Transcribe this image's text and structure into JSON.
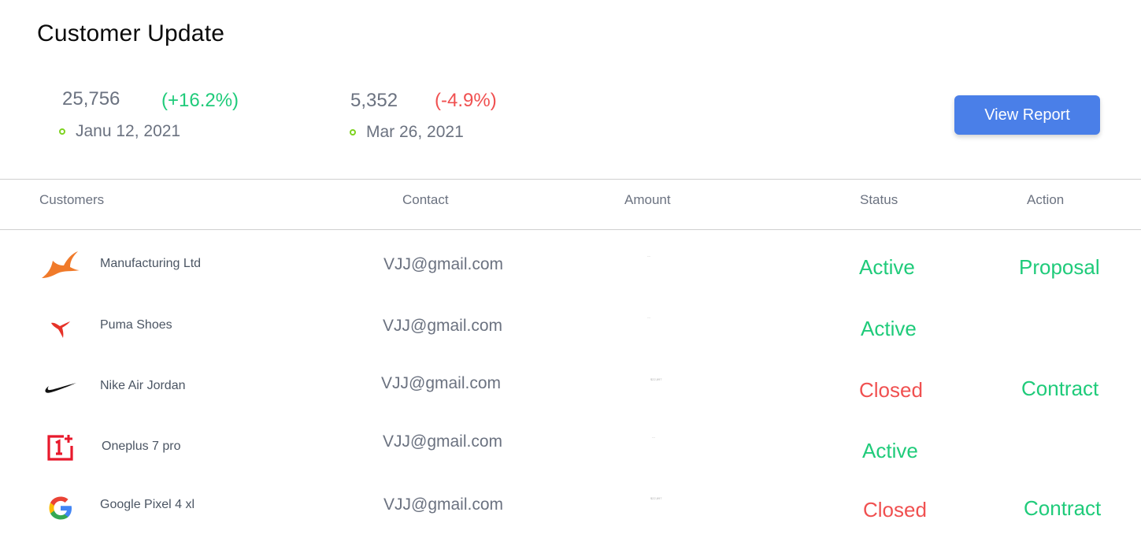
{
  "page_title": "Customer Update",
  "stats": [
    {
      "value": "25,756",
      "change": "(+16.2%)",
      "change_color": "#1fcb7a",
      "date": "Janu 12, 2021"
    },
    {
      "value": "5,352",
      "change": "(-4.9%)",
      "change_color": "#f05050",
      "date": "Mar 26, 2021"
    }
  ],
  "view_report_label": "View Report",
  "table": {
    "headers": [
      "Customers",
      "Contact",
      "Amount",
      "Status",
      "Action"
    ],
    "rows": [
      {
        "logo": "fanatic-logo-icon",
        "name": "Manufacturing Ltd",
        "email": "VJJ@gmail.com",
        "amount": "---",
        "status": "Active",
        "action": "Proposal"
      },
      {
        "logo": "puma-logo-icon",
        "name": "Puma Shoes",
        "email": "VJJ@gmail.com",
        "amount": "---",
        "status": "Active",
        "action": ""
      },
      {
        "logo": "nike-logo-icon",
        "name": "Nike Air Jordan",
        "email": "VJJ@gmail.com",
        "amount": "$22,897",
        "status": "Closed",
        "action": "Contract"
      },
      {
        "logo": "oneplus-logo-icon",
        "name": "Oneplus 7 pro",
        "email": "VJJ@gmail.com",
        "amount": "---",
        "status": "Active",
        "action": ""
      },
      {
        "logo": "google-logo-icon",
        "name": "Google Pixel 4 xl",
        "email": "VJJ@gmail.com",
        "amount": "$22,897",
        "status": "Closed",
        "action": "Contract"
      }
    ]
  },
  "colors": {
    "active": "#1fcb7a",
    "closed": "#f05050",
    "accent": "#4a7fe8"
  }
}
